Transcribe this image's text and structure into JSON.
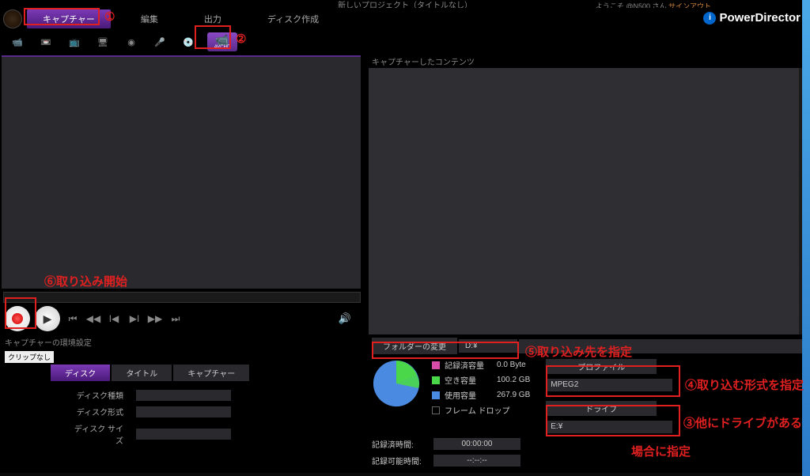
{
  "window": {
    "title": "新しいプロジェクト（タイトルなし）"
  },
  "top_status": {
    "text1": "ようこそ @N500 さん",
    "text2": "サインアウト"
  },
  "brand": {
    "name": "PowerDirector",
    "icon_label": "i"
  },
  "menu": {
    "capture": "キャプチャー",
    "edit": "編集",
    "output": "出力",
    "disc": "ディスク作成"
  },
  "avchd": {
    "label": "AVCHD"
  },
  "content": {
    "header": "キャプチャーしたコンテンツ"
  },
  "settings": {
    "title": "キャプチャーの環境設定",
    "clip_label": "クリップなし",
    "tabs": {
      "disc": "ディスク",
      "title": "タイトル",
      "capture": "キャプチャー"
    },
    "props": {
      "type": "ディスク種類",
      "format": "ディスク形式",
      "size": "ディスク サイズ"
    }
  },
  "folder": {
    "button": "フォルダーの変更",
    "path": "D:¥"
  },
  "stats": {
    "recorded_label": "記録済容量",
    "recorded_val": "0.0 Byte",
    "free_label": "空き容量",
    "free_val": "100.2 GB",
    "used_label": "使用容量",
    "used_val": "267.9 GB",
    "frame_drop": "フレーム ドロップ",
    "colors": {
      "recorded": "#d94ca8",
      "free": "#4ad84a",
      "used": "#4a8ae0"
    }
  },
  "profile": {
    "label": "プロファイル",
    "value": "MPEG2"
  },
  "drive": {
    "label": "ドライブ",
    "value": "E:¥"
  },
  "times": {
    "recorded_label": "記録済時間:",
    "recorded_val": "00:00:00",
    "possible_label": "記録可能時間:",
    "possible_val": "--:--:--"
  },
  "chart_data": {
    "type": "pie",
    "title": "",
    "series": [
      {
        "name": "記録済容量",
        "value": 0.0,
        "unit": "Byte",
        "color": "#d94ca8"
      },
      {
        "name": "空き容量",
        "value": 100.2,
        "unit": "GB",
        "color": "#4ad84a"
      },
      {
        "name": "使用容量",
        "value": 267.9,
        "unit": "GB",
        "color": "#4a8ae0"
      }
    ]
  },
  "annotations": {
    "n1": "①",
    "n2": "②",
    "n3": "③",
    "n4": "④",
    "n5": "⑤",
    "t6": "⑥取り込み開始",
    "t5": "⑤取り込み先を指定",
    "t4": "④取り込む形式を指定",
    "t3": "③他にドライブがある",
    "t3b": "場合に指定"
  }
}
